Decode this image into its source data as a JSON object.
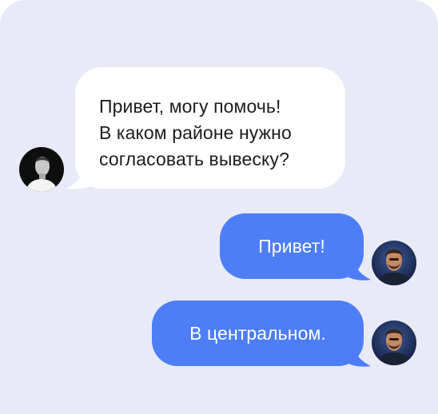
{
  "chat": {
    "messages": [
      {
        "sender": "agent",
        "lines": [
          "Привет, могу помочь!",
          "В каком районе нужно",
          "согласовать вывеску?"
        ]
      },
      {
        "sender": "user",
        "text": "Привет!"
      },
      {
        "sender": "user",
        "text": "В центральном."
      }
    ],
    "colors": {
      "background": "#e9eaf8",
      "incoming_bubble": "#ffffff",
      "outgoing_bubble": "#4d7ef7"
    },
    "icons": {
      "agent_avatar": "agent-avatar-photo",
      "user_avatar": "user-avatar-photo"
    }
  }
}
